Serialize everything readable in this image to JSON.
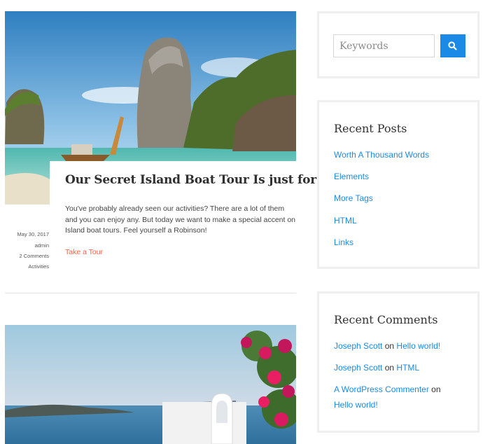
{
  "posts": [
    {
      "title": "Our Secret Island Boat Tour Is just for You",
      "excerpt": "You've probably already seen our activities? There are a lot of them and you can enjoy any. But today we want to make a special accent on Island boat tours. Feel yourself a Robinson!",
      "read_more": "Take a Tour",
      "date": "May 30, 2017",
      "author": "admin",
      "comments": "2 Comments",
      "category": "Activities"
    }
  ],
  "search": {
    "placeholder": "Keywords",
    "icon": "search-icon"
  },
  "recent_posts": {
    "title": "Recent Posts",
    "items": [
      "Worth A Thousand Words",
      "Elements",
      "More Tags",
      "HTML",
      "Links"
    ]
  },
  "recent_comments": {
    "title": "Recent Comments",
    "items": [
      {
        "author": "Joseph Scott",
        "on": "on",
        "post": "Hello world!"
      },
      {
        "author": "Joseph Scott",
        "on": "on",
        "post": "HTML"
      },
      {
        "author": "A WordPress Commenter",
        "on": "on",
        "post": "Hello world!"
      }
    ]
  },
  "colors": {
    "accent": "#1a8ae6",
    "link_red": "#f06449",
    "border": "#efefef"
  }
}
